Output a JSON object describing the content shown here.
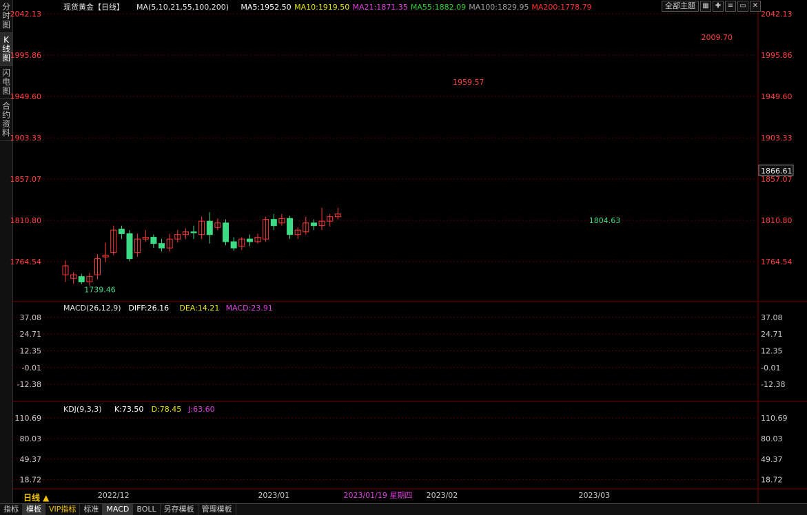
{
  "title": "现货黄金【日线】",
  "period_label": "日线 ▲",
  "side_tabs": [
    "分时图",
    "K线图",
    "闪电图",
    "合约资料"
  ],
  "theme_button": "全部主题",
  "ma_legend": [
    {
      "label": "MA(5,10,21,55,100,200)",
      "color": "#e6e6e6"
    },
    {
      "label": "MA5:1952.50",
      "color": "#ffffff"
    },
    {
      "label": "MA10:1919.50",
      "color": "#e6e600"
    },
    {
      "label": "MA21:1871.35",
      "color": "#e040e0"
    },
    {
      "label": "MA55:1882.09",
      "color": "#30d030"
    },
    {
      "label": "MA100:1829.95",
      "color": "#a0a0a0"
    },
    {
      "label": "MA200:1778.79",
      "color": "#ff3030"
    }
  ],
  "macd_legend": [
    {
      "label": "MACD(26,12,9)",
      "color": "#e6e6e6"
    },
    {
      "label": "DIFF:26.16",
      "color": "#ffffff"
    },
    {
      "label": "DEA:14.21",
      "color": "#e6e600"
    },
    {
      "label": "MACD:23.91",
      "color": "#e040e0"
    }
  ],
  "kdj_legend": [
    {
      "label": "KDJ(9,3,3)",
      "color": "#e6e6e6"
    },
    {
      "label": "K:73.50",
      "color": "#ffffff"
    },
    {
      "label": "D:78.45",
      "color": "#e6e600"
    },
    {
      "label": "J:63.60",
      "color": "#e040e0"
    }
  ],
  "colors": {
    "up": "#ff3b3b",
    "down": "#3ddc84",
    "axis_text": "#ff4040",
    "grid": "#5a0000"
  },
  "bottom_tabs": [
    "指标",
    "模板",
    "VIP指标",
    "标准",
    "MACD",
    "BOLL",
    "另存模板",
    "管理模板"
  ],
  "chart_data": {
    "type": "candlestick",
    "price_axis": {
      "ticks": [
        2042.13,
        1995.86,
        1949.6,
        1903.33,
        1857.07,
        1810.8,
        1764.54
      ],
      "range": [
        1720,
        2042.13
      ]
    },
    "current_price": "1866.61",
    "annotations": [
      {
        "label": "2009.70",
        "value": 2009.7,
        "index": 79
      },
      {
        "label": "1959.57",
        "value": 1959.57,
        "index": 48
      },
      {
        "label": "1804.63",
        "value": 1804.63,
        "index": 65
      },
      {
        "label": "1739.46",
        "value": 1739.46,
        "index": 2
      }
    ],
    "date_labels": [
      {
        "label": "2022/12",
        "index": 6
      },
      {
        "label": "2023/01",
        "index": 26
      },
      {
        "label": "2023/01/19 星期四",
        "index": 39
      },
      {
        "label": "2023/02",
        "index": 47
      },
      {
        "label": "2023/03",
        "index": 66
      }
    ],
    "candles": [
      [
        1750,
        1760,
        1742,
        1766
      ],
      [
        1746,
        1750,
        1740,
        1753
      ],
      [
        1748,
        1742,
        1739.46,
        1751
      ],
      [
        1742,
        1748,
        1738,
        1752
      ],
      [
        1750,
        1768,
        1745,
        1773
      ],
      [
        1770,
        1772,
        1764,
        1786
      ],
      [
        1775,
        1800,
        1772,
        1805
      ],
      [
        1801,
        1796,
        1790,
        1805
      ],
      [
        1796,
        1768,
        1765,
        1800
      ],
      [
        1775,
        1790,
        1770,
        1796
      ],
      [
        1790,
        1792,
        1787,
        1800
      ],
      [
        1792,
        1785,
        1780,
        1795
      ],
      [
        1785,
        1780,
        1776,
        1790
      ],
      [
        1780,
        1790,
        1776,
        1796
      ],
      [
        1790,
        1795,
        1786,
        1800
      ],
      [
        1795,
        1798,
        1790,
        1802
      ],
      [
        1798,
        1797,
        1790,
        1805
      ],
      [
        1795,
        1810,
        1790,
        1815
      ],
      [
        1810,
        1795,
        1785,
        1820
      ],
      [
        1803,
        1808,
        1800,
        1813
      ],
      [
        1808,
        1787,
        1783,
        1812
      ],
      [
        1787,
        1780,
        1777,
        1792
      ],
      [
        1782,
        1790,
        1778,
        1792
      ],
      [
        1790,
        1787,
        1782,
        1795
      ],
      [
        1787,
        1792,
        1785,
        1796
      ],
      [
        1790,
        1812,
        1787,
        1815
      ],
      [
        1812,
        1805,
        1800,
        1818
      ],
      [
        1808,
        1813,
        1805,
        1818
      ],
      [
        1813,
        1795,
        1790,
        1816
      ],
      [
        1795,
        1800,
        1790,
        1803
      ],
      [
        1798,
        1808,
        1795,
        1815
      ],
      [
        1808,
        1805,
        1800,
        1812
      ],
      [
        1805,
        1810,
        1800,
        1825
      ],
      [
        1810,
        1815,
        1804,
        1818
      ],
      [
        1815,
        1818,
        1812,
        1825
      ]
    ],
    "macd": {
      "axis_ticks": [
        37.08,
        24.71,
        12.35,
        -0.01,
        -12.38
      ],
      "range": [
        -25,
        40
      ]
    },
    "kdj": {
      "axis_ticks": [
        110.69,
        80.03,
        49.37,
        18.72
      ],
      "range": [
        5,
        118
      ]
    }
  }
}
